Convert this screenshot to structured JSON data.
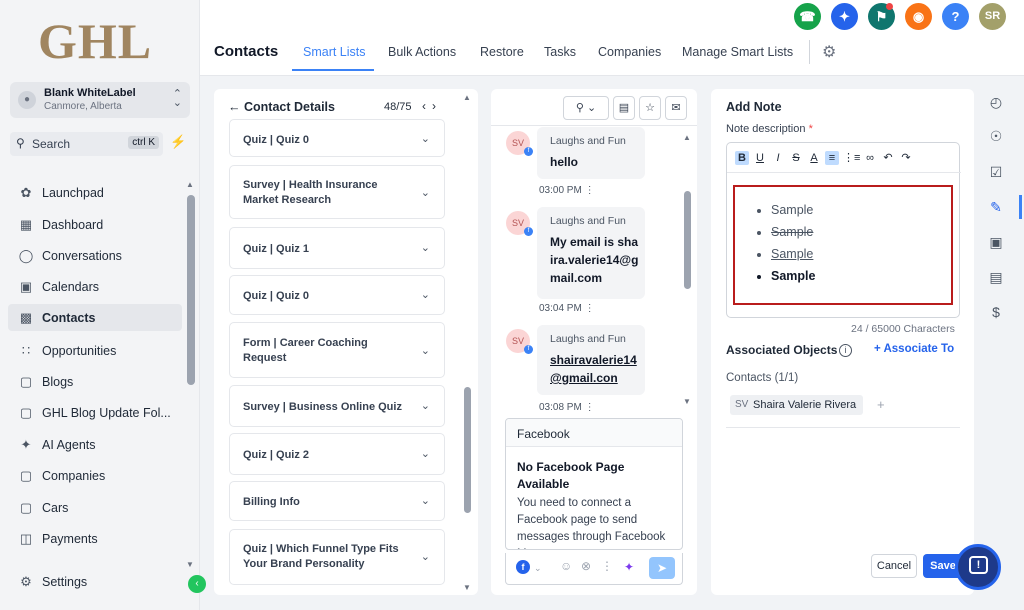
{
  "brand": {
    "logo_text": "GHL"
  },
  "account": {
    "name": "Blank WhiteLabel",
    "location": "Canmore, Alberta"
  },
  "search": {
    "label": "Search",
    "shortcut": "ctrl K"
  },
  "sidebar": {
    "items": [
      {
        "label": "Launchpad",
        "icon": "rocket-icon"
      },
      {
        "label": "Dashboard",
        "icon": "grid-icon"
      },
      {
        "label": "Conversations",
        "icon": "chat-icon"
      },
      {
        "label": "Calendars",
        "icon": "calendar-icon"
      },
      {
        "label": "Contacts",
        "icon": "contacts-icon",
        "active": true
      },
      {
        "label": "Opportunities",
        "icon": "opportunities-icon"
      },
      {
        "label": "Blogs",
        "icon": "cube-icon"
      },
      {
        "label": "GHL Blog Update Fol...",
        "icon": "cube-icon"
      },
      {
        "label": "AI Agents",
        "icon": "sparkle-icon"
      },
      {
        "label": "Companies",
        "icon": "cube-icon"
      },
      {
        "label": "Cars",
        "icon": "cube-icon"
      },
      {
        "label": "Payments",
        "icon": "payments-icon"
      }
    ],
    "settings_label": "Settings"
  },
  "header": {
    "title": "Contacts",
    "tabs": [
      {
        "label": "Smart Lists",
        "active": true
      },
      {
        "label": "Bulk Actions"
      },
      {
        "label": "Restore"
      },
      {
        "label": "Tasks"
      },
      {
        "label": "Companies"
      },
      {
        "label": "Manage Smart Lists"
      }
    ],
    "user_initials": "SR",
    "help_label": "?"
  },
  "contact_details": {
    "title": "Contact Details",
    "count": "48/75",
    "cards": [
      "Quiz | Quiz 0",
      "Survey | Health Insurance Market Research",
      "Quiz | Quiz 1",
      "Quiz | Quiz 0",
      "Form | Career Coaching Request",
      "Survey | Business Online Quiz",
      "Quiz | Quiz 2",
      "Billing Info",
      "Quiz | Which Funnel Type Fits Your Brand Personality"
    ]
  },
  "conversation": {
    "messages": [
      {
        "initials": "SV",
        "sender": "Laughs and Fun",
        "text": "hello",
        "time": "03:00 PM"
      },
      {
        "initials": "SV",
        "sender": "Laughs and Fun",
        "text": "My email is shaira.valerie14@gmail.com",
        "time": "03:04 PM"
      },
      {
        "initials": "SV",
        "sender": "Laughs and Fun",
        "text": "shairavalerie14@gmail.con",
        "time": "03:08 PM"
      }
    ],
    "channel": {
      "name": "Facebook",
      "title": "No Facebook Page Available",
      "text": "You need to connect a Facebook page to send messages through Facebook Messenger"
    }
  },
  "note": {
    "title": "Add Note",
    "desc_label": "Note description",
    "required_mark": "*",
    "items": [
      "Sample",
      "Sample",
      "Sample",
      "Sample"
    ],
    "char_count": "24 / 65000 Characters",
    "associated_title": "Associated Objects",
    "associate_link": "+ Associate To",
    "contacts_label": "Contacts (1/1)",
    "contact_chip_initials": "SV",
    "contact_chip_name": "Shaira Valerie Rivera",
    "cancel_label": "Cancel",
    "save_label": "Save"
  },
  "colors": {
    "primary": "#2563eb",
    "phone_button": "#16a34a",
    "ai_button": "#2563eb",
    "megaphone_button": "#0f766e",
    "bell_button": "#f97316",
    "help_button": "#3b82f6",
    "avatar": "#a3a06a",
    "editor_highlight": "#b91c1c"
  }
}
